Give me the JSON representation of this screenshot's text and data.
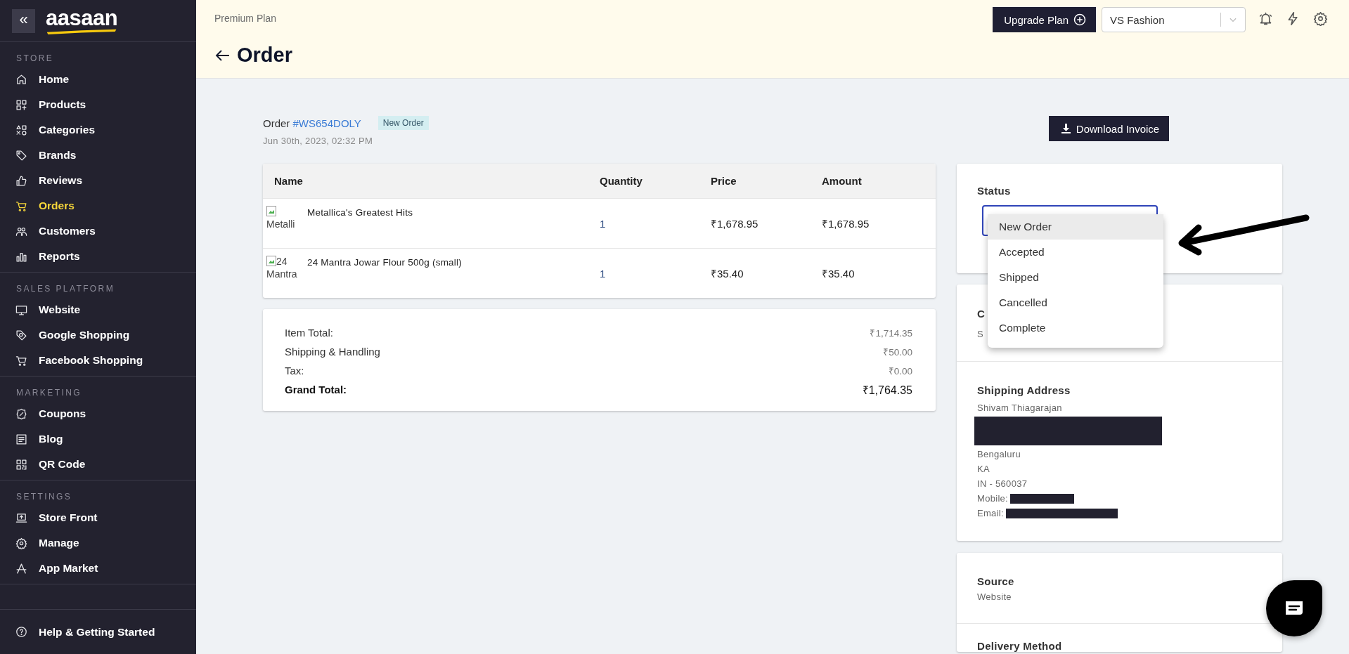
{
  "sidebar": {
    "collapse_button": "«",
    "logo": "aasaan",
    "sections": [
      {
        "title": "STORE",
        "items": [
          {
            "label": "Home",
            "selected": false
          },
          {
            "label": "Products",
            "selected": false
          },
          {
            "label": "Categories",
            "selected": false
          },
          {
            "label": "Brands",
            "selected": false
          },
          {
            "label": "Reviews",
            "selected": false
          },
          {
            "label": "Orders",
            "selected": true
          },
          {
            "label": "Customers",
            "selected": false
          },
          {
            "label": "Reports",
            "selected": false
          }
        ]
      },
      {
        "title": "SALES PLATFORM",
        "items": [
          {
            "label": "Website",
            "selected": false
          },
          {
            "label": "Google Shopping",
            "selected": false
          },
          {
            "label": "Facebook Shopping",
            "selected": false
          }
        ]
      },
      {
        "title": "MARKETING",
        "items": [
          {
            "label": "Coupons",
            "selected": false
          },
          {
            "label": "Blog",
            "selected": false
          },
          {
            "label": "QR Code",
            "selected": false
          }
        ]
      },
      {
        "title": "SETTINGS",
        "items": [
          {
            "label": "Store Front",
            "selected": false
          },
          {
            "label": "Manage",
            "selected": false
          },
          {
            "label": "App Market",
            "selected": false
          }
        ]
      }
    ],
    "help": "Help & Getting Started"
  },
  "header": {
    "plan": "Premium Plan",
    "title": "Order",
    "upgrade_button": "Upgrade Plan",
    "store_select": {
      "value": "VS Fashion"
    }
  },
  "order": {
    "label": "Order",
    "number": "#WS654DOLY",
    "badge": "New Order",
    "date": "Jun 30th, 2023, 02:32 PM",
    "download_button": "Download Invoice",
    "table": {
      "columns": [
        "Name",
        "Quantity",
        "Price",
        "Amount"
      ],
      "rows": [
        {
          "image_alt": "Metalli",
          "name": "Metallica's Greatest Hits",
          "quantity": "1",
          "price": "₹1,678.95",
          "amount": "₹1,678.95"
        },
        {
          "image_alt": "24 Mantra",
          "name": "24 Mantra Jowar Flour 500g (small)",
          "quantity": "1",
          "price": "₹35.40",
          "amount": "₹35.40"
        }
      ]
    },
    "summary": [
      {
        "kind": "line",
        "label": "Item Total:",
        "value": "₹1,714.35"
      },
      {
        "kind": "line",
        "label": "Shipping & Handling",
        "value": "₹50.00"
      },
      {
        "kind": "line",
        "label": "Tax:",
        "value": "₹0.00"
      },
      {
        "kind": "total",
        "label": "Grand Total:",
        "value": "₹1,764.35"
      }
    ]
  },
  "status": {
    "title": "Status",
    "options": [
      {
        "label": "New Order",
        "selected": true
      },
      {
        "label": "Accepted",
        "selected": false
      },
      {
        "label": "Shipped",
        "selected": false
      },
      {
        "label": "Cancelled",
        "selected": false
      },
      {
        "label": "Complete",
        "selected": false
      }
    ]
  },
  "customer": {
    "title": "C",
    "line": "S"
  },
  "shipping": {
    "title": "Shipping Address",
    "lines": [
      {
        "kind": "text",
        "text": "Shivam Thiagarajan"
      },
      {
        "kind": "redacted"
      },
      {
        "kind": "text",
        "text": "Bengaluru"
      },
      {
        "kind": "text",
        "text": "KA"
      },
      {
        "kind": "text",
        "text": "IN - 560037"
      },
      {
        "kind": "redacted",
        "label": "Mobile:"
      },
      {
        "kind": "redacted",
        "label": "Email:"
      }
    ]
  },
  "source": {
    "title": "Source",
    "value": "Website"
  },
  "delivery": {
    "title": "Delivery Method"
  }
}
